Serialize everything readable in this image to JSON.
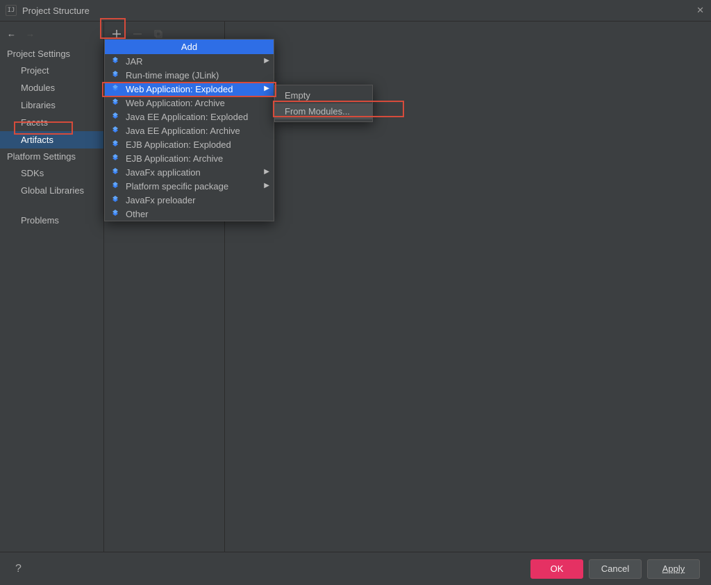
{
  "window": {
    "title": "Project Structure"
  },
  "sidebar": {
    "sections": [
      {
        "header": "Project Settings",
        "items": [
          {
            "label": "Project"
          },
          {
            "label": "Modules"
          },
          {
            "label": "Libraries"
          },
          {
            "label": "Facets"
          },
          {
            "label": "Artifacts",
            "selected": true
          }
        ]
      },
      {
        "header": "Platform Settings",
        "items": [
          {
            "label": "SDKs"
          },
          {
            "label": "Global Libraries"
          }
        ]
      },
      {
        "header": "",
        "items": [
          {
            "label": "Problems",
            "class": "problems"
          }
        ]
      }
    ]
  },
  "add_menu": {
    "header": "Add",
    "items": [
      {
        "label": "JAR",
        "arrow": true
      },
      {
        "label": "Run-time image (JLink)"
      },
      {
        "label": "Web Application: Exploded",
        "arrow": true,
        "highlight": true
      },
      {
        "label": "Web Application: Archive"
      },
      {
        "label": "Java EE Application: Exploded"
      },
      {
        "label": "Java EE Application: Archive"
      },
      {
        "label": "EJB Application: Exploded"
      },
      {
        "label": "EJB Application: Archive"
      },
      {
        "label": "JavaFx application",
        "arrow": true
      },
      {
        "label": "Platform specific package",
        "arrow": true
      },
      {
        "label": "JavaFx preloader"
      },
      {
        "label": "Other"
      }
    ]
  },
  "submenu": {
    "items": [
      {
        "label": "Empty"
      },
      {
        "label": "From Modules...",
        "active": true
      }
    ]
  },
  "footer": {
    "ok": "OK",
    "cancel": "Cancel",
    "apply": "Apply"
  }
}
